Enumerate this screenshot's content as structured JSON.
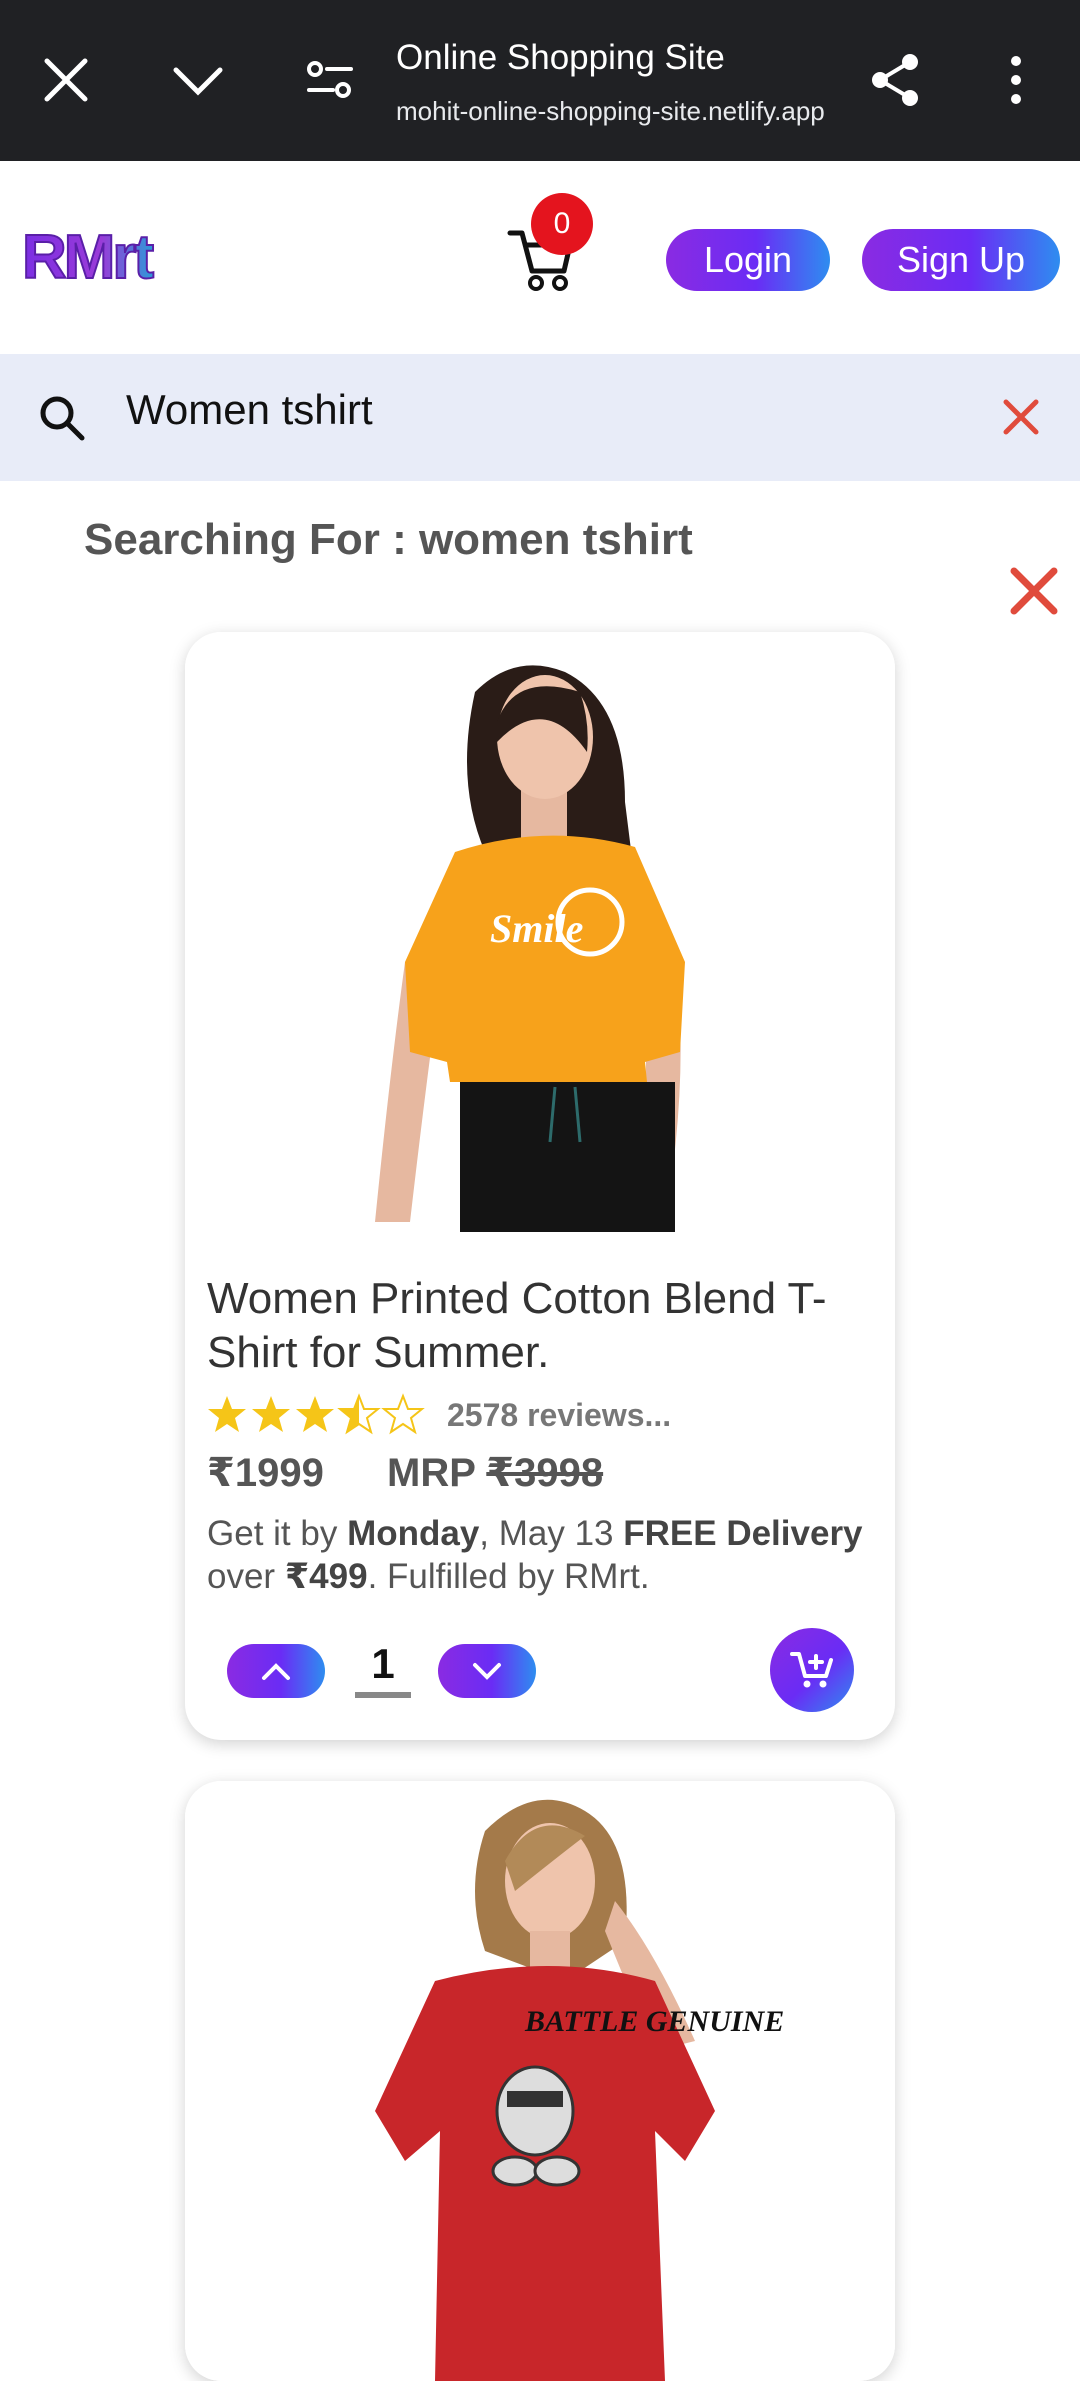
{
  "browser": {
    "title": "Online Shopping Site",
    "url": "mohit-online-shopping-site.netlify.app",
    "icons": [
      "close-icon",
      "chevron-down-icon",
      "site-settings-icon",
      "share-icon",
      "more-vert-icon"
    ]
  },
  "header": {
    "logo_text": "RMrt",
    "cart_count": "0",
    "login_label": "Login",
    "signup_label": "Sign Up"
  },
  "search": {
    "value": "Women tshirt"
  },
  "results": {
    "heading": "Searching For : women tshirt"
  },
  "products": [
    {
      "title": "Women Printed Cotton Blend T-Shirt for Summer.",
      "rating": 3.5,
      "reviews": "2578 reviews...",
      "price": "₹1999",
      "mrp_label": "MRP",
      "mrp": "₹3998",
      "delivery_prefix": "Get it by ",
      "delivery_day": "Monday",
      "delivery_date": ", May 13 ",
      "free_delivery": "FREE Delivery",
      "delivery_over": " over ",
      "delivery_threshold": "₹499",
      "delivery_suffix": ". Fulfilled by RMrt.",
      "quantity": "1",
      "shirt_color": "#f7a21b",
      "print_text": "Smile"
    },
    {
      "shirt_color": "#c8262a",
      "print_text": "BATTLE GENUINE"
    }
  ],
  "colors": {
    "accent_start": "#8a2be2",
    "accent_end": "#2e8df0",
    "badge": "#e4141e",
    "clear_x": "#e04b3c",
    "star": "#f5c518"
  }
}
